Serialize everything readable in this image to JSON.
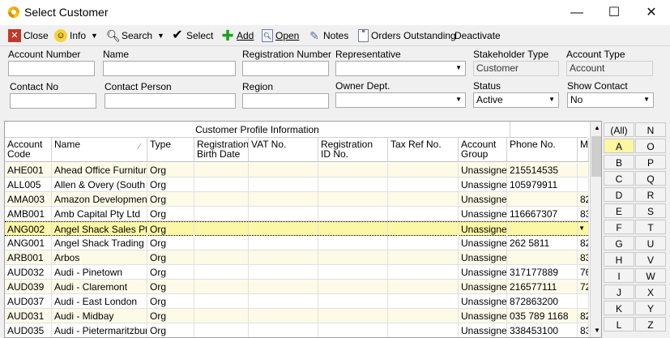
{
  "window": {
    "title": "Select Customer",
    "minimize": "—",
    "maximize": "☐",
    "close": "✕"
  },
  "toolbar": {
    "close": "Close",
    "info": "Info",
    "search": "Search",
    "select": "Select",
    "add": "Add",
    "open": "Open",
    "notes": "Notes",
    "orders_outstanding": "Orders Outstanding",
    "deactivate": "Deactivate"
  },
  "filters": {
    "account_number": {
      "label": "Account Number",
      "value": ""
    },
    "name": {
      "label": "Name",
      "value": ""
    },
    "registration_number": {
      "label": "Registration Number",
      "value": ""
    },
    "representative": {
      "label": "Representative",
      "value": ""
    },
    "stakeholder_type": {
      "label": "Stakeholder Type",
      "value": "Customer"
    },
    "account_type": {
      "label": "Account Type",
      "value": "Account"
    },
    "contact_no": {
      "label": "Contact No",
      "value": ""
    },
    "contact_person": {
      "label": "Contact Person",
      "value": ""
    },
    "region": {
      "label": "Region",
      "value": ""
    },
    "owner_dept": {
      "label": "Owner Dept.",
      "value": ""
    },
    "status": {
      "label": "Status",
      "value": "Active"
    },
    "show_contact": {
      "label": "Show Contact",
      "value": "No"
    }
  },
  "grid": {
    "group_header": "Customer Profile Information",
    "columns": [
      {
        "key": "code",
        "l1": "Account",
        "l2": "Code"
      },
      {
        "key": "name",
        "l1": "Name",
        "l2": ""
      },
      {
        "key": "type",
        "l1": "Type",
        "l2": ""
      },
      {
        "key": "reg_birth",
        "l1": "Registration",
        "l2": "Birth Date"
      },
      {
        "key": "vat",
        "l1": "VAT No.",
        "l2": ""
      },
      {
        "key": "reg_id",
        "l1": "Registration",
        "l2": "ID No."
      },
      {
        "key": "tax",
        "l1": "Tax Ref No.",
        "l2": ""
      },
      {
        "key": "group",
        "l1": "Account",
        "l2": "Group"
      },
      {
        "key": "phone",
        "l1": "Phone No.",
        "l2": ""
      },
      {
        "key": "m",
        "l1": "M",
        "l2": ""
      }
    ],
    "rows": [
      {
        "code": "AHE001",
        "name": "Ahead Office Furniture I",
        "type": "Org",
        "group": "Unassignec",
        "phone": "215514535",
        "m": ""
      },
      {
        "code": "ALL005",
        "name": "Allen & Overy (South Af",
        "type": "Org",
        "group": "Unassignec",
        "phone": "105979911",
        "m": ""
      },
      {
        "code": "AMA003",
        "name": "Amazon Development C",
        "type": "Org",
        "group": "Unassignec",
        "phone": "",
        "m": "82"
      },
      {
        "code": "AMB001",
        "name": "Amb Capital Pty Ltd",
        "type": "Org",
        "group": "Unassignec",
        "phone": "116667307",
        "m": "83"
      },
      {
        "code": "ANG002",
        "name": "Angel Shack Sales Pty",
        "type": "Org",
        "group": "Unassignec",
        "phone": "",
        "m": ""
      },
      {
        "code": "ANG001",
        "name": "Angel Shack Trading &",
        "type": "Org",
        "group": "Unassignec",
        "phone": "262 5811",
        "m": "82"
      },
      {
        "code": "ARB001",
        "name": "Arbos",
        "type": "Org",
        "group": "Unassignec",
        "phone": "",
        "m": "83"
      },
      {
        "code": "AUD032",
        "name": "Audi - Pinetown",
        "type": "Org",
        "group": "Unassignec",
        "phone": "317177889",
        "m": "76"
      },
      {
        "code": "AUD039",
        "name": "Audi - Claremont",
        "type": "Org",
        "group": "Unassignec",
        "phone": "216577111",
        "m": "72"
      },
      {
        "code": "AUD037",
        "name": "Audi - East London",
        "type": "Org",
        "group": "Unassignec",
        "phone": "872863200",
        "m": ""
      },
      {
        "code": "AUD031",
        "name": "Audi - Midbay",
        "type": "Org",
        "group": "Unassignec",
        "phone": "035 789 1168",
        "m": "82"
      },
      {
        "code": "AUD035",
        "name": "Audi - Pietermaritzburg",
        "type": "Org",
        "group": "Unassignec",
        "phone": "338453100",
        "m": "83"
      }
    ],
    "selected_row": "ANG002"
  },
  "alpha": {
    "left": [
      "(All)",
      "A",
      "B",
      "C",
      "D",
      "E",
      "F",
      "G",
      "H",
      "I",
      "J",
      "K",
      "L"
    ],
    "right": [
      "N",
      "O",
      "P",
      "Q",
      "R",
      "S",
      "T",
      "U",
      "V",
      "W",
      "X",
      "Y",
      "Z"
    ],
    "active": "A"
  },
  "colors": {
    "selected_row": "#fbf7a6",
    "alt_row": "#fdfbe8",
    "active_letter": "#fdf6a5"
  }
}
